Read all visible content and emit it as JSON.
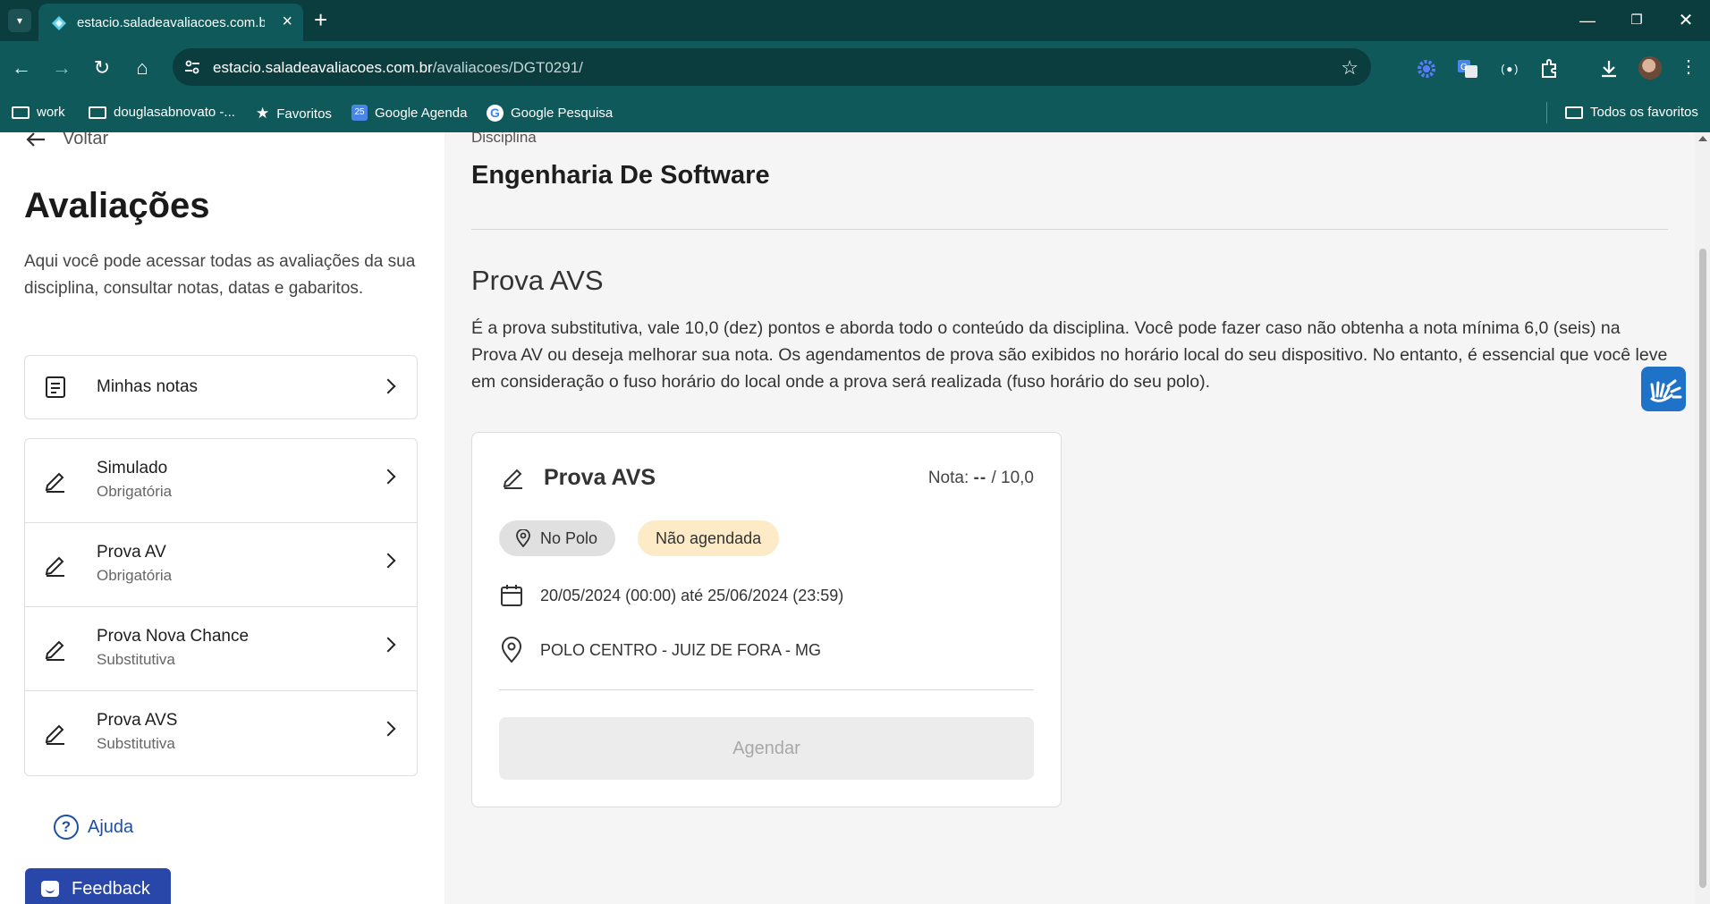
{
  "browser": {
    "tab_title": "estacio.saladeavaliacoes.com.br",
    "url_host": "estacio.saladeavaliacoes.com.br",
    "url_path": "/avaliacoes/DGT0291/",
    "bookmarks": [
      {
        "label": "work",
        "icon": "folder-icon"
      },
      {
        "label": "douglasabnovato -...",
        "icon": "folder-icon"
      },
      {
        "label": "Favoritos",
        "icon": "star-icon"
      },
      {
        "label": "Google Agenda",
        "icon": "calendar-icon"
      },
      {
        "label": "Google Pesquisa",
        "icon": "google-icon"
      }
    ],
    "all_bookmarks_label": "Todos os favoritos"
  },
  "sidebar": {
    "back_label": "Voltar",
    "title": "Avaliações",
    "description": "Aqui você pode acessar todas as avaliações da sua disciplina, consultar notas, datas e gabaritos.",
    "grades_link": "Minhas notas",
    "items": [
      {
        "title": "Simulado",
        "subtitle": "Obrigatória"
      },
      {
        "title": "Prova AV",
        "subtitle": "Obrigatória"
      },
      {
        "title": "Prova Nova Chance",
        "subtitle": "Substitutiva"
      },
      {
        "title": "Prova AVS",
        "subtitle": "Substitutiva"
      }
    ],
    "help_label": "Ajuda",
    "feedback_label": "Feedback"
  },
  "main": {
    "discipline_label": "Disciplina",
    "discipline_name": "Engenharia De Software",
    "section_title": "Prova AVS",
    "section_description": "É a prova substitutiva, vale 10,0 (dez) pontos e aborda todo o conteúdo da disciplina. Você pode fazer caso não obtenha a nota mínima 6,0 (seis) na Prova AV ou deseja melhorar sua nota. Os agendamentos de prova são exibidos no horário local do seu dispositivo. No entanto, é essencial que você leve em consideração o fuso horário do local onde a prova será realizada (fuso horário do seu polo).",
    "card": {
      "title": "Prova AVS",
      "grade_label": "Nota:",
      "grade_value": "--",
      "grade_max": "/ 10,0",
      "chip_location": "No Polo",
      "chip_status": "Não agendada",
      "date_range": "20/05/2024 (00:00) até 25/06/2024 (23:59)",
      "location": "POLO CENTRO - JUIZ DE FORA - MG",
      "button": "Agendar"
    }
  },
  "colors": {
    "chrome_dark": "#0b3d3f",
    "chrome": "#10595b",
    "feedback": "#2947a9",
    "link": "#1d4fa8",
    "chip_yellow": "#fcebc6",
    "vlibras": "#1e73c9"
  }
}
